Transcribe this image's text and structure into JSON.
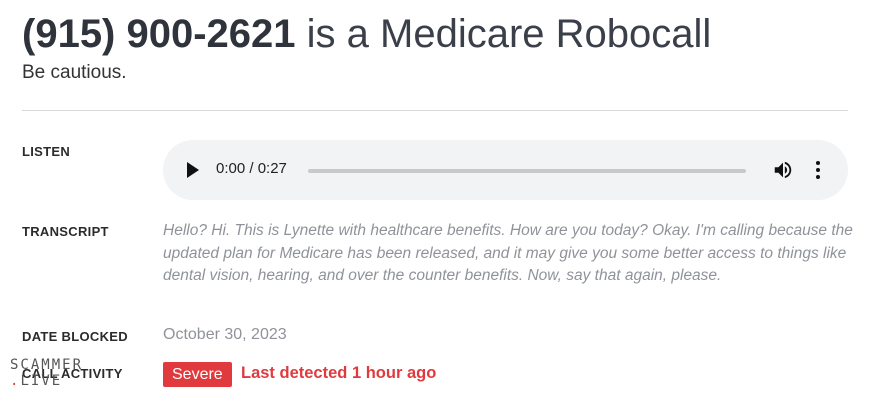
{
  "header": {
    "phone_number": "(915) 900-2621",
    "title_suffix": "is a Medicare Robocall",
    "subtitle": "Be cautious."
  },
  "listen": {
    "label": "LISTEN",
    "time": "0:00 / 0:27",
    "progress": 0,
    "icons": [
      "play-icon",
      "volume-icon",
      "more-options-icon"
    ]
  },
  "transcript": {
    "label": "TRANSCRIPT",
    "text": "Hello? Hi. This is Lynette with healthcare benefits. How are you today? Okay. I'm calling because the updated plan for Medicare has been released, and it may give you some better access to things like dental vision, hearing, and over the counter benefits. Now, say that again, please."
  },
  "date_blocked": {
    "label": "DATE BLOCKED",
    "value": "October 30, 2023"
  },
  "call_activity": {
    "label": "CALL ACTIVITY",
    "severity": "Severe",
    "detected": "Last detected 1 hour ago"
  },
  "watermark": {
    "line1": "SCAMMER",
    "dot": ".",
    "line2": "LIVE"
  },
  "colors": {
    "alert": "#e03a3e",
    "muted_text": "#8f9399",
    "player_bg": "#f1f3f4"
  }
}
